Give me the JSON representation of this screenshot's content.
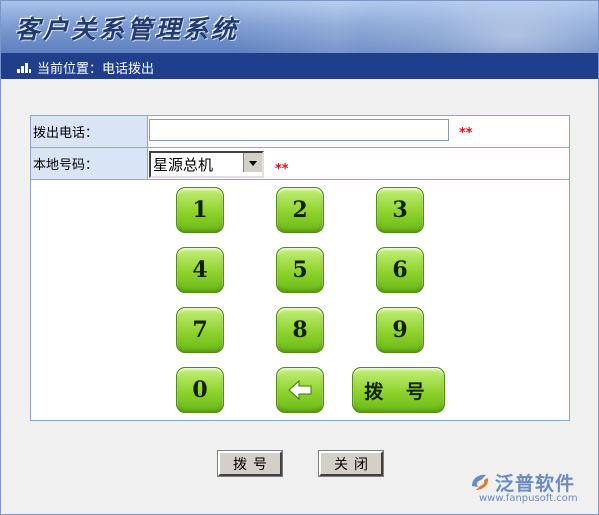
{
  "app": {
    "title": "客户关系管理系统"
  },
  "breadcrumb": {
    "text": "当前位置：电话拨出"
  },
  "form": {
    "phone_label": "拨出电话：",
    "phone_value": "",
    "required_mark": "**",
    "local_label": "本地号码：",
    "local_selected": "星源总机"
  },
  "keypad": {
    "keys": [
      "1",
      "2",
      "3",
      "4",
      "5",
      "6",
      "7",
      "8",
      "9",
      "0"
    ],
    "backspace_icon": "arrow-left-icon",
    "dial_label": "拨 号",
    "color": "#8fd32c"
  },
  "footer": {
    "dial_button": "拨号",
    "close_button": "关闭"
  },
  "watermark": {
    "name": "泛普软件",
    "url": "www.fanpusoft.com"
  },
  "colors": {
    "breadcrumb_bg": "#1f3f8c",
    "label_bg": "#d9e4f7",
    "required": "#e01010"
  }
}
